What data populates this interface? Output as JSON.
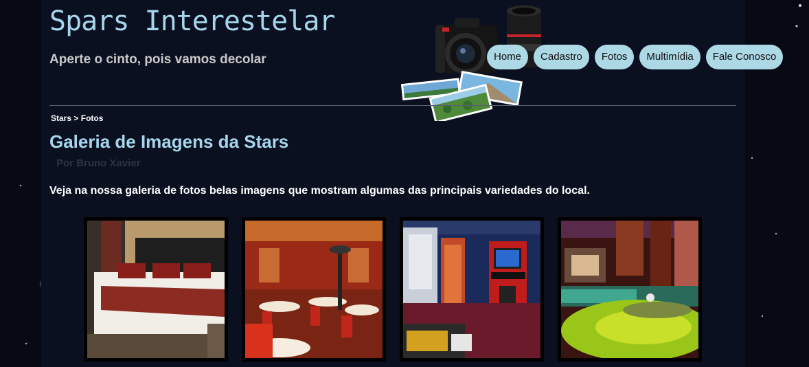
{
  "site": {
    "title": "Spars Interestelar",
    "tagline": "Aperte o cinto, pois vamos decolar"
  },
  "nav": {
    "items": [
      {
        "label": "Home"
      },
      {
        "label": "Cadastro"
      },
      {
        "label": "Fotos"
      },
      {
        "label": "Multimídia"
      },
      {
        "label": "Fale Conosco"
      }
    ]
  },
  "breadcrumb": {
    "parent": "Stars",
    "separator": ">",
    "current": "Fotos"
  },
  "gallery": {
    "title": "Galeria de Imagens da Stars",
    "byline": "Por Bruno Xavier",
    "intro": "Veja na nossa galeria de fotos belas imagens que mostram algumas das principais variedades do local.",
    "photos": [
      {
        "subject": "hotel bedroom"
      },
      {
        "subject": "restaurant dining room"
      },
      {
        "subject": "arcade game room"
      },
      {
        "subject": "indoor jacuzzi pool"
      }
    ]
  },
  "colors": {
    "background": "#070a14",
    "title": "#a6d6ec",
    "nav_button": "#add8e6",
    "byline": "#2c3444"
  }
}
